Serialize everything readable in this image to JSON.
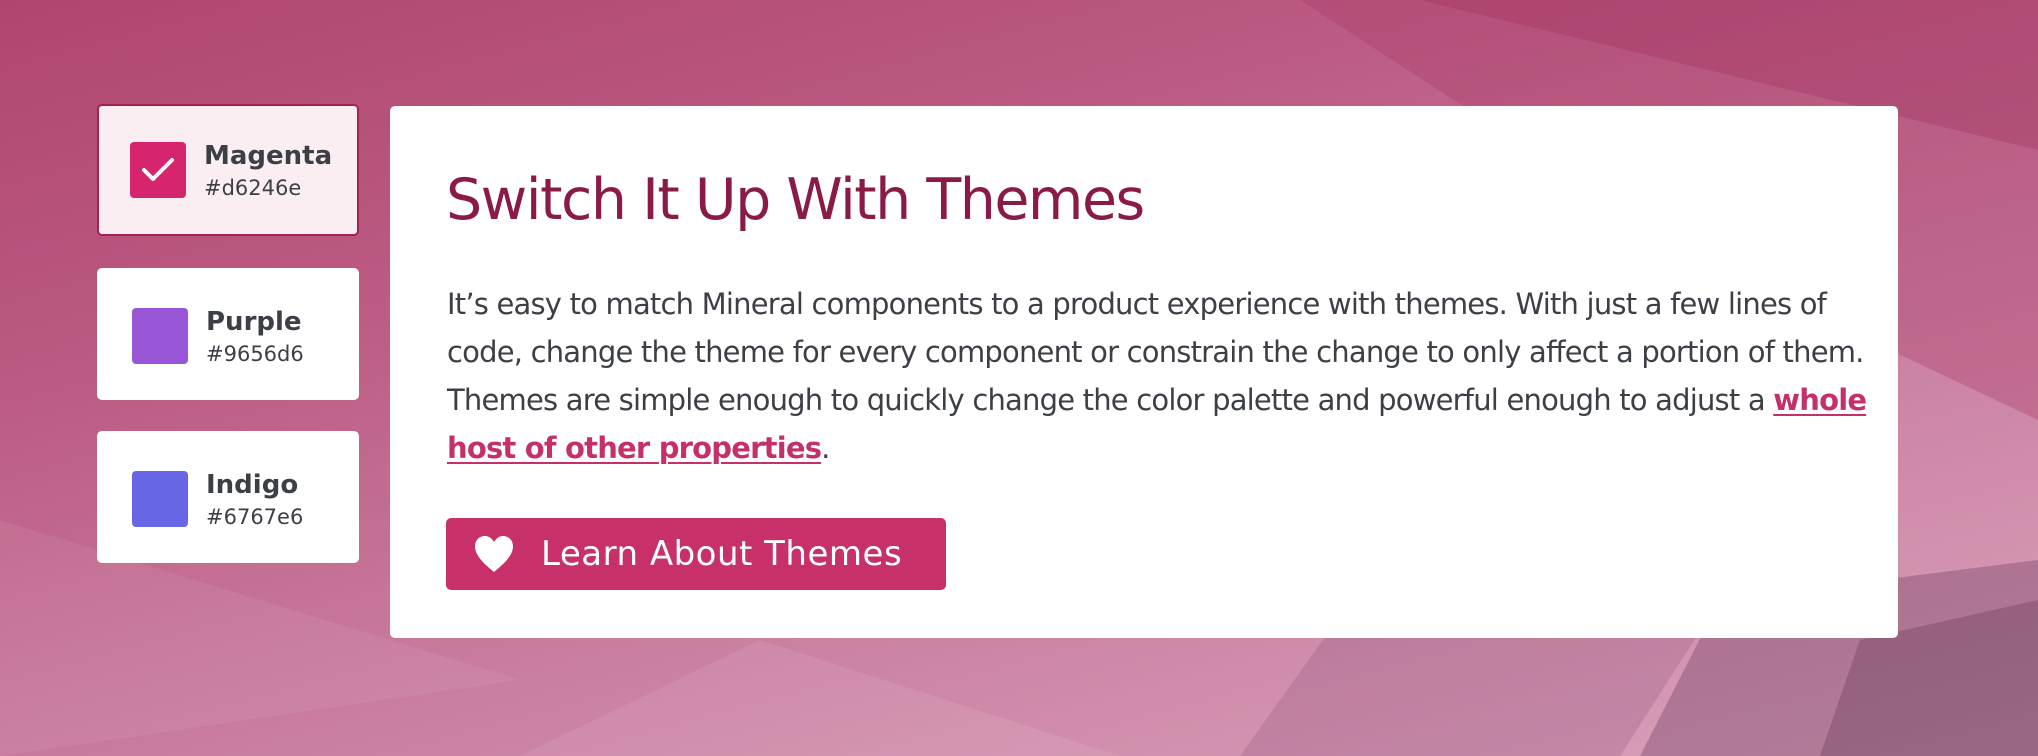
{
  "colors": {
    "selected_border": "#a3234f",
    "selected_background": "#fbeef3",
    "title": "#8a1a47",
    "link": "#c4306a",
    "button": "#c8306a",
    "body_text": "#3c3f46"
  },
  "themes": [
    {
      "name": "Magenta",
      "hex_label": "#d6246e",
      "color": "#d6246e",
      "selected": true,
      "icon": "checkmark-icon"
    },
    {
      "name": "Purple",
      "hex_label": "#9656d6",
      "color": "#9656d6",
      "selected": false
    },
    {
      "name": "Indigo",
      "hex_label": "#6767e6",
      "color": "#6767e6",
      "selected": false
    }
  ],
  "card": {
    "title": "Switch It Up With Themes",
    "body_before_link": "It’s easy to match Mineral components to a product experience with themes. With just a few lines of code, change the theme for every component or constrain the change to only affect a portion of them. Themes are simple enough to quickly change the color palette and powerful enough to adjust a ",
    "link_text": "whole host of other properties",
    "body_after_link": ".",
    "button": {
      "label": "Learn About Themes",
      "icon": "heart-icon"
    }
  }
}
